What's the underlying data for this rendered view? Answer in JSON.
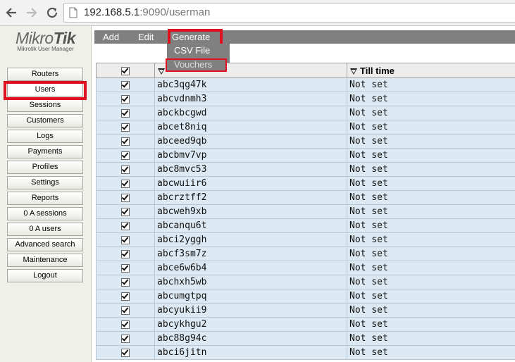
{
  "browser": {
    "url_host": "192.168.5.1",
    "url_rest": ":9090/userman"
  },
  "logo": {
    "brand_light": "Mikro",
    "brand_bold": "Tik",
    "subtitle": "Mikrotik User Manager"
  },
  "sidebar": {
    "items": [
      {
        "label": "Routers"
      },
      {
        "label": "Users"
      },
      {
        "label": "Sessions"
      },
      {
        "label": "Customers"
      },
      {
        "label": "Logs"
      },
      {
        "label": "Payments"
      },
      {
        "label": "Profiles"
      },
      {
        "label": "Settings"
      },
      {
        "label": "Reports"
      },
      {
        "label": "0 A sessions"
      },
      {
        "label": "0 A users"
      },
      {
        "label": "Advanced search"
      },
      {
        "label": "Maintenance"
      },
      {
        "label": "Logout"
      }
    ],
    "selected": "Users"
  },
  "toolbar": {
    "add_label": "Add",
    "edit_label": "Edit",
    "generate_label": "Generate"
  },
  "generate_menu": {
    "csv_label": "CSV File",
    "vouchers_label": "Vouchers"
  },
  "table": {
    "columns": [
      "",
      "Till time"
    ],
    "rows": [
      {
        "username": "abc3qg47k",
        "till_time": "Not set"
      },
      {
        "username": "abcvdnmh3",
        "till_time": "Not set"
      },
      {
        "username": "abckbcgwd",
        "till_time": "Not set"
      },
      {
        "username": "abcet8niq",
        "till_time": "Not set"
      },
      {
        "username": "abceed9qb",
        "till_time": "Not set"
      },
      {
        "username": "abcbmv7vp",
        "till_time": "Not set"
      },
      {
        "username": "abc8mvc53",
        "till_time": "Not set"
      },
      {
        "username": "abcwuiir6",
        "till_time": "Not set"
      },
      {
        "username": "abcrztff2",
        "till_time": "Not set"
      },
      {
        "username": "abcweh9xb",
        "till_time": "Not set"
      },
      {
        "username": "abcanqu6t",
        "till_time": "Not set"
      },
      {
        "username": "abci2yggh",
        "till_time": "Not set"
      },
      {
        "username": "abcf3sm7z",
        "till_time": "Not set"
      },
      {
        "username": "abce6w6b4",
        "till_time": "Not set"
      },
      {
        "username": "abchxh5wb",
        "till_time": "Not set"
      },
      {
        "username": "abcumgtpq",
        "till_time": "Not set"
      },
      {
        "username": "abcyukii9",
        "till_time": "Not set"
      },
      {
        "username": "abcykhgu2",
        "till_time": "Not set"
      },
      {
        "username": "abc88g94c",
        "till_time": "Not set"
      },
      {
        "username": "abci6jitn",
        "till_time": "Not set"
      }
    ]
  },
  "colors": {
    "highlight": "#e01020",
    "toolbar": "#808080",
    "row_bg": "#dce9f2"
  }
}
